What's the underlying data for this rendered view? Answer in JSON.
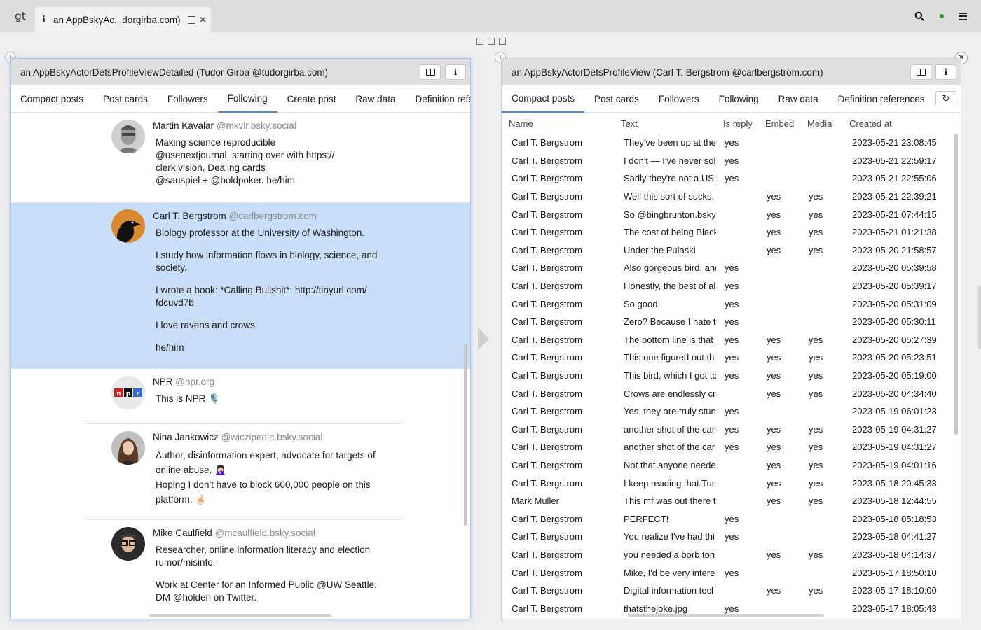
{
  "window": {
    "logo": "gt",
    "tab_title": "an AppBskyAc...dorgirba.com)"
  },
  "left_pane": {
    "title": "an AppBskyActorDefsProfileViewDetailed (Tudor Girba @tudorgirba.com)",
    "tabs": [
      "Compact posts",
      "Post cards",
      "Followers",
      "Following",
      "Create post",
      "Raw data",
      "Definition refere"
    ],
    "active_tab": "Following",
    "people": [
      {
        "name": "Martin Kavalar",
        "handle": "@mkvlr.bsky.social",
        "bio": [
          "Making science reproducible\n@usenextjournal, starting over with https://\nclerk.vision. Dealing cards\n@sauspiel + @boldpoker. he/him"
        ]
      },
      {
        "name": "Carl T. Bergstrom",
        "handle": "@carlbergstrom.com",
        "bio": [
          "Biology professor at the University of Washington.",
          "I study how information flows in biology, science, and society.",
          "I wrote a book: *Calling Bullshit*: http://tinyurl.com/\nfdcuvd7b",
          "I love ravens and crows.",
          "he/him"
        ]
      },
      {
        "name": "NPR",
        "handle": "@npr.org",
        "bio": [
          "This is NPR 🎙️"
        ]
      },
      {
        "name": "Nina Jankowicz",
        "handle": "@wiczipedia.bsky.social",
        "bio": [
          "Author, disinformation expert, advocate for targets of online abuse. 🤦🏻‍♀️\nHoping I don't have to block 600,000 people on this platform. 🤞🏻"
        ]
      },
      {
        "name": "Mike Caulfield",
        "handle": "@mcaulfield.bsky.social",
        "bio": [
          "Researcher, online information literacy and election rumor/misinfo.",
          "Work at Center for an Informed Public @UW Seattle.\nDM @holden on Twitter."
        ]
      }
    ]
  },
  "right_pane": {
    "title": "an AppBskyActorDefsProfileView (Carl T. Bergstrom @carlbergstrom.com)",
    "tabs": [
      "Compact posts",
      "Post cards",
      "Followers",
      "Following",
      "Raw data",
      "Definition references"
    ],
    "active_tab": "Compact posts",
    "columns": [
      "Name",
      "Text",
      "Is reply",
      "Embed",
      "Media",
      "Created at"
    ],
    "rows": [
      [
        "Carl T. Bergstrom",
        "They've been up at the",
        "yes",
        "",
        "",
        "2023-05-21 23:08:45"
      ],
      [
        "Carl T. Bergstrom",
        "I don't — I've never sold",
        "yes",
        "",
        "",
        "2023-05-21 22:59:17"
      ],
      [
        "Carl T. Bergstrom",
        "Sadly they're not a US-",
        "yes",
        "",
        "",
        "2023-05-21 22:55:06"
      ],
      [
        "Carl T. Bergstrom",
        "Well this sort of sucks.",
        "",
        "yes",
        "yes",
        "2023-05-21 22:39:21"
      ],
      [
        "Carl T. Bergstrom",
        "So @bingbrunton.bsky",
        "",
        "yes",
        "yes",
        "2023-05-21 07:44:15"
      ],
      [
        "Carl T. Bergstrom",
        "The cost of being Black",
        "",
        "yes",
        "yes",
        "2023-05-21 01:21:38"
      ],
      [
        "Carl T. Bergstrom",
        "Under the Pulaski",
        "",
        "yes",
        "yes",
        "2023-05-20 21:58:57"
      ],
      [
        "Carl T. Bergstrom",
        "Also gorgeous bird, and",
        "yes",
        "",
        "",
        "2023-05-20 05:39:58"
      ],
      [
        "Carl T. Bergstrom",
        "Honestly, the best of all",
        "yes",
        "",
        "",
        "2023-05-20 05:39:17"
      ],
      [
        "Carl T. Bergstrom",
        "So good.",
        "yes",
        "",
        "",
        "2023-05-20 05:31:09"
      ],
      [
        "Carl T. Bergstrom",
        "Zero? Because I hate to",
        "yes",
        "",
        "",
        "2023-05-20 05:30:11"
      ],
      [
        "Carl T. Bergstrom",
        "The bottom line is that",
        "yes",
        "yes",
        "yes",
        "2023-05-20 05:27:39"
      ],
      [
        "Carl T. Bergstrom",
        "This one figured out th",
        "yes",
        "yes",
        "yes",
        "2023-05-20 05:23:51"
      ],
      [
        "Carl T. Bergstrom",
        "This bird, which I got to",
        "yes",
        "yes",
        "yes",
        "2023-05-20 05:19:00"
      ],
      [
        "Carl T. Bergstrom",
        "Crows are endlessly cre",
        "",
        "yes",
        "yes",
        "2023-05-20 04:34:40"
      ],
      [
        "Carl T. Bergstrom",
        "Yes, they are truly stun",
        "yes",
        "",
        "",
        "2023-05-19 06:01:23"
      ],
      [
        "Carl T. Bergstrom",
        "another shot of the car",
        "yes",
        "yes",
        "yes",
        "2023-05-19 04:31:27"
      ],
      [
        "Carl T. Bergstrom",
        "another shot of the car",
        "yes",
        "yes",
        "yes",
        "2023-05-19 04:31:27"
      ],
      [
        "Carl T. Bergstrom",
        "Not that anyone neede",
        "",
        "yes",
        "yes",
        "2023-05-19 04:01:16"
      ],
      [
        "Carl T. Bergstrom",
        "I keep reading that Tur",
        "",
        "yes",
        "yes",
        "2023-05-18 20:45:33"
      ],
      [
        "Mark Muller",
        "This mf was out there t",
        "",
        "yes",
        "yes",
        "2023-05-18 12:44:55"
      ],
      [
        "Carl T. Bergstrom",
        "PERFECT!",
        "yes",
        "",
        "",
        "2023-05-18 05:18:53"
      ],
      [
        "Carl T. Bergstrom",
        "You realize I've had thi",
        "yes",
        "",
        "",
        "2023-05-18 04:41:27"
      ],
      [
        "Carl T. Bergstrom",
        "you needed a borb ton",
        "",
        "yes",
        "yes",
        "2023-05-18 04:14:37"
      ],
      [
        "Carl T. Bergstrom",
        "Mike, I'd be very intere",
        "yes",
        "",
        "",
        "2023-05-17 18:50:10"
      ],
      [
        "Carl T. Bergstrom",
        "Digital information tecl",
        "",
        "yes",
        "yes",
        "2023-05-17 18:10:00"
      ],
      [
        "Carl T. Bergstrom",
        "thatsthejoke.jpg",
        "yes",
        "",
        "",
        "2023-05-17 18:05:43"
      ]
    ]
  },
  "icons": {
    "search": "search-icon",
    "status": "status-dot-icon",
    "menu": "hamburger-menu-icon",
    "book": "book-icon",
    "inspect": "inspect-i-icon",
    "refresh": "refresh-icon"
  },
  "colors": {
    "selection": "#c9def8",
    "active_tab_underline": "#4a90d9",
    "status_dot": "#20a020"
  }
}
